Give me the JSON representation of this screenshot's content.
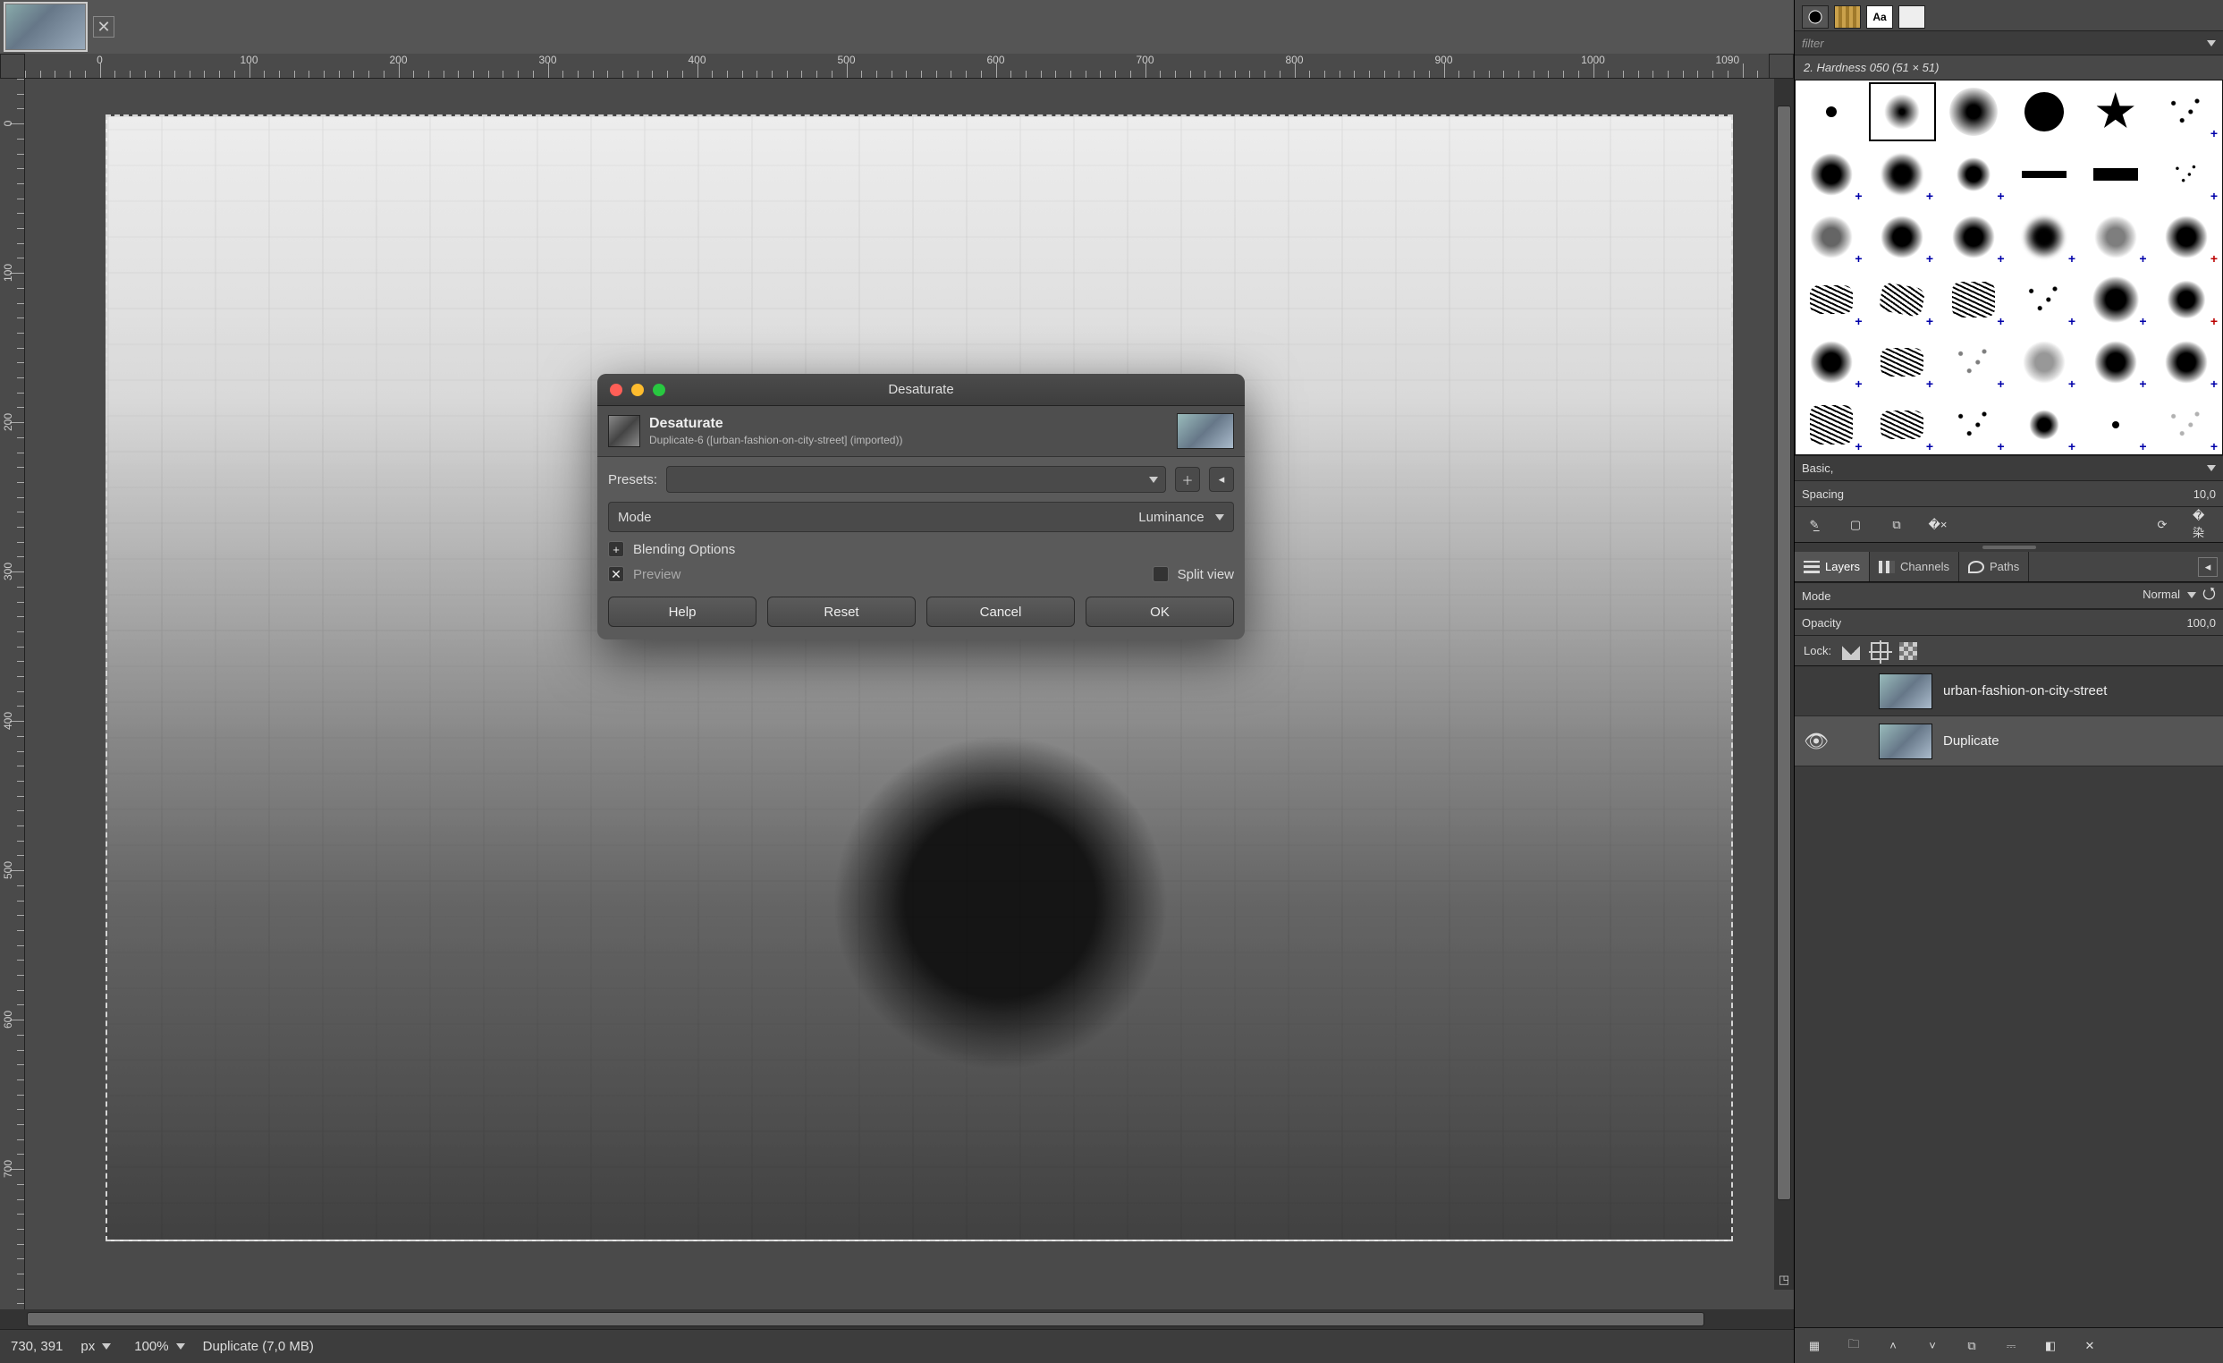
{
  "image_tabs": [
    {
      "active": true
    }
  ],
  "ruler": {
    "h_labels": [
      0,
      100,
      200,
      300,
      400,
      500,
      600,
      700,
      800,
      900,
      1000,
      1090
    ],
    "v_labels": [
      0,
      100,
      200,
      300,
      400,
      500,
      600,
      700
    ]
  },
  "dialog": {
    "title": "Desaturate",
    "header_title": "Desaturate",
    "header_subtitle": "Duplicate-6 ([urban-fashion-on-city-street] (imported))",
    "presets_label": "Presets:",
    "mode_label": "Mode",
    "mode_value": "Luminance",
    "blending_label": "Blending Options",
    "preview_label": "Preview",
    "preview_checked": true,
    "split_label": "Split view",
    "split_checked": false,
    "buttons": {
      "help": "Help",
      "reset": "Reset",
      "cancel": "Cancel",
      "ok": "OK"
    }
  },
  "status": {
    "coords": "730, 391",
    "unit": "px",
    "zoom": "100%",
    "layer_info": "Duplicate (7,0 MB)"
  },
  "brush_panel": {
    "filter_placeholder": "filter",
    "title": "2. Hardness 050 (51 × 51)",
    "preset_combo": "Basic,",
    "spacing_label": "Spacing",
    "spacing_value": "10,0"
  },
  "layer_panel": {
    "tabs": {
      "layers": "Layers",
      "channels": "Channels",
      "paths": "Paths"
    },
    "mode_label": "Mode",
    "mode_value": "Normal",
    "opacity_label": "Opacity",
    "opacity_value": "100,0",
    "lock_label": "Lock:",
    "layers": [
      {
        "name": "urban-fashion-on-city-street",
        "visible": false,
        "selected": false
      },
      {
        "name": "Duplicate",
        "visible": true,
        "selected": true
      }
    ]
  }
}
